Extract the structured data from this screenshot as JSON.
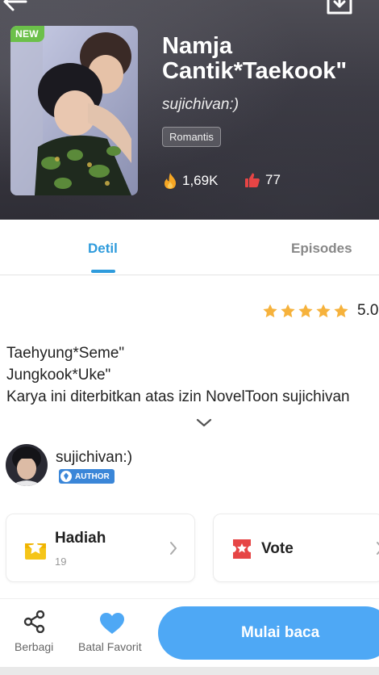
{
  "header": {
    "new_badge": "NEW",
    "title": "Namja\nCantik*Taekook\"",
    "author": "sujichivan:)",
    "genre": "Romantis",
    "views": "1,69K",
    "likes": "77",
    "icons": {
      "back": "back-arrow-icon",
      "download": "download-icon",
      "views": "fire-icon",
      "likes": "thumbs-up-icon"
    }
  },
  "tabs": [
    {
      "label": "Detil",
      "active": true
    },
    {
      "label": "Episodes",
      "active": false
    }
  ],
  "rating": {
    "value": "5.0",
    "stars": 5,
    "star_color": "#f6b23c"
  },
  "description": {
    "lines": [
      "Taehyung*Seme\"",
      "Jungkook*Uke\"",
      "Karya ini diterbitkan atas izin NovelToon sujichivan"
    ]
  },
  "author_info": {
    "name": "sujichivan:)",
    "badge": "AUTHOR"
  },
  "cards": {
    "hadiah": {
      "label": "Hadiah",
      "count": "19",
      "icon": "gift-icon"
    },
    "vote": {
      "label": "Vote",
      "icon": "ticket-icon"
    }
  },
  "bottom_bar": {
    "share_label": "Berbagi",
    "favorite_label": "Batal Favorit",
    "read_label": "Mulai baca"
  },
  "colors": {
    "accent": "#2e9bdc",
    "read_button": "#4ea8f5",
    "new_badge": "#6cc04a"
  }
}
